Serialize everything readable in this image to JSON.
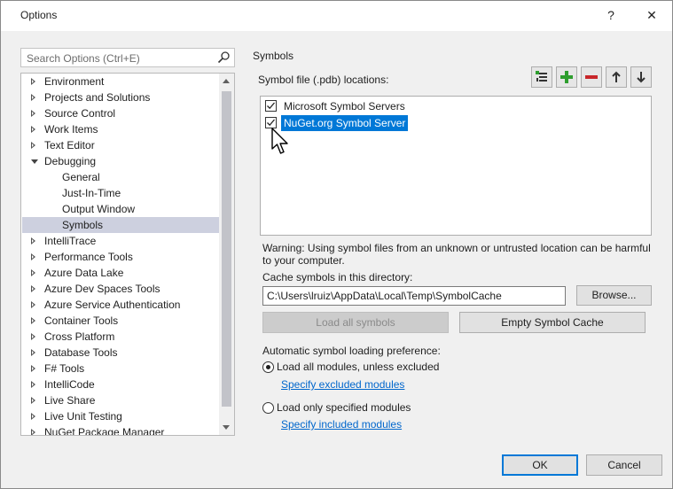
{
  "window": {
    "title": "Options",
    "help_glyph": "?",
    "close_glyph": "✕"
  },
  "search": {
    "placeholder": "Search Options (Ctrl+E)",
    "value": ""
  },
  "tree": {
    "items": [
      {
        "label": "Environment",
        "level": 0,
        "expander": "collapsed"
      },
      {
        "label": "Projects and Solutions",
        "level": 0,
        "expander": "collapsed"
      },
      {
        "label": "Source Control",
        "level": 0,
        "expander": "collapsed"
      },
      {
        "label": "Work Items",
        "level": 0,
        "expander": "collapsed"
      },
      {
        "label": "Text Editor",
        "level": 0,
        "expander": "collapsed"
      },
      {
        "label": "Debugging",
        "level": 0,
        "expander": "expanded"
      },
      {
        "label": "General",
        "level": 1,
        "expander": "none"
      },
      {
        "label": "Just-In-Time",
        "level": 1,
        "expander": "none"
      },
      {
        "label": "Output Window",
        "level": 1,
        "expander": "none"
      },
      {
        "label": "Symbols",
        "level": 1,
        "expander": "none",
        "selected": true
      },
      {
        "label": "IntelliTrace",
        "level": 0,
        "expander": "collapsed"
      },
      {
        "label": "Performance Tools",
        "level": 0,
        "expander": "collapsed"
      },
      {
        "label": "Azure Data Lake",
        "level": 0,
        "expander": "collapsed"
      },
      {
        "label": "Azure Dev Spaces Tools",
        "level": 0,
        "expander": "collapsed"
      },
      {
        "label": "Azure Service Authentication",
        "level": 0,
        "expander": "collapsed"
      },
      {
        "label": "Container Tools",
        "level": 0,
        "expander": "collapsed"
      },
      {
        "label": "Cross Platform",
        "level": 0,
        "expander": "collapsed"
      },
      {
        "label": "Database Tools",
        "level": 0,
        "expander": "collapsed"
      },
      {
        "label": "F# Tools",
        "level": 0,
        "expander": "collapsed"
      },
      {
        "label": "IntelliCode",
        "level": 0,
        "expander": "collapsed"
      },
      {
        "label": "Live Share",
        "level": 0,
        "expander": "collapsed"
      },
      {
        "label": "Live Unit Testing",
        "level": 0,
        "expander": "collapsed"
      },
      {
        "label": "NuGet Package Manager",
        "level": 0,
        "expander": "collapsed"
      }
    ]
  },
  "symbols": {
    "section_title": "Symbols",
    "locations_label": "Symbol file (.pdb) locations:",
    "toolbar": [
      "load-list-icon",
      "add-icon",
      "remove-icon",
      "move-up-icon",
      "move-down-icon"
    ],
    "locations": [
      {
        "label": "Microsoft Symbol Servers",
        "checked": true,
        "selected": false
      },
      {
        "label": "NuGet.org Symbol Server",
        "checked": true,
        "selected": true
      }
    ],
    "warning": "Warning: Using symbol files from an unknown or untrusted location can be harmful to your computer.",
    "cache_label": "Cache symbols in this directory:",
    "cache_path": "C:\\Users\\lruiz\\AppData\\Local\\Temp\\SymbolCache",
    "browse_label": "Browse...",
    "load_all_label": "Load all symbols",
    "empty_cache_label": "Empty Symbol Cache",
    "preference_label": "Automatic symbol loading preference:",
    "option_all": "Load all modules, unless excluded",
    "link_excluded": "Specify excluded modules",
    "option_specified": "Load only specified modules",
    "link_included": "Specify included modules",
    "selected_option": "all"
  },
  "footer": {
    "ok_label": "OK",
    "cancel_label": "Cancel"
  },
  "colors": {
    "selection": "#0078d7",
    "tree_selection": "#cdd0df",
    "link": "#0066cc",
    "add_green": "#2e9e2e",
    "remove_red": "#c8262a"
  }
}
